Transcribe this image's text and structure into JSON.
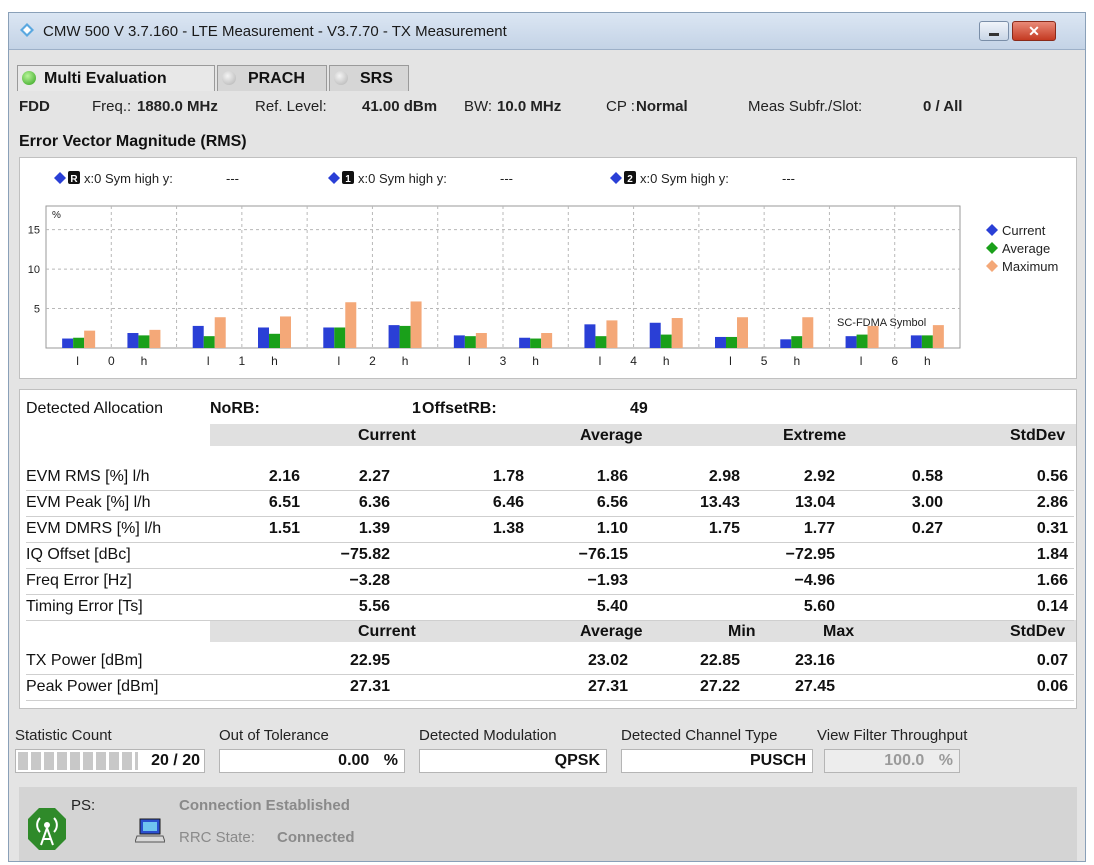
{
  "window": {
    "title": "CMW 500 V 3.7.160 - LTE Measurement  - V3.7.70 - TX Measurement",
    "close_glyph": "✕"
  },
  "tabs": [
    {
      "label": "Multi Evaluation",
      "active": true,
      "led": "#3fbf2a"
    },
    {
      "label": "PRACH",
      "active": false,
      "led": "#c8c8c8"
    },
    {
      "label": "SRS",
      "active": false,
      "led": "#c8c8c8"
    }
  ],
  "info": {
    "duplex": "FDD",
    "freq_label": "Freq.:",
    "freq_value": "1880.0 MHz",
    "ref_label": "Ref. Level:",
    "ref_value": "41.00 dBm",
    "bw_label": "BW:",
    "bw_value": "10.0 MHz",
    "cp_label": "CP :",
    "cp_value": "Normal",
    "subfr_label": "Meas Subfr./Slot:",
    "subfr_value": "0  / All"
  },
  "section_title": "Error Vector Magnitude (RMS)",
  "markers": [
    {
      "tag": "R",
      "text": "x:0 Sym high y:",
      "value": "---"
    },
    {
      "tag": "1",
      "text": "x:0 Sym high y:",
      "value": "---"
    },
    {
      "tag": "2",
      "text": "x:0 Sym high y:",
      "value": "---"
    }
  ],
  "chart_data": {
    "type": "bar",
    "ylabel": "%",
    "ylim": [
      0,
      18
    ],
    "yticks": [
      5,
      10,
      15
    ],
    "grid": true,
    "legend_position": "right",
    "annotation": "SC-FDMA Symbol",
    "categories": [
      "0 l",
      "0 h",
      "1 l",
      "1 h",
      "2 l",
      "2 h",
      "3 l",
      "3 h",
      "4 l",
      "4 h",
      "5 l",
      "5 h",
      "6 l",
      "6 h"
    ],
    "tick_labels": [
      {
        "l": "l",
        "n": "0",
        "h": "h"
      },
      {
        "l": "l",
        "n": "1",
        "h": "h"
      },
      {
        "l": "l",
        "n": "2",
        "h": "h"
      },
      {
        "l": "l",
        "n": "3",
        "h": "h"
      },
      {
        "l": "l",
        "n": "4",
        "h": "h"
      },
      {
        "l": "l",
        "n": "5",
        "h": "h"
      },
      {
        "l": "l",
        "n": "6",
        "h": "h"
      }
    ],
    "series": [
      {
        "name": "Current",
        "color": "#2a3fd6",
        "values": [
          1.2,
          1.9,
          2.8,
          2.6,
          2.6,
          2.9,
          1.6,
          1.3,
          3.0,
          3.2,
          1.4,
          1.1,
          1.5,
          1.6
        ]
      },
      {
        "name": "Average",
        "color": "#1aa01a",
        "values": [
          1.3,
          1.6,
          1.5,
          1.8,
          2.6,
          2.8,
          1.5,
          1.2,
          1.5,
          1.7,
          1.4,
          1.5,
          1.7,
          1.6
        ]
      },
      {
        "name": "Maximum",
        "color": "#f4a878",
        "values": [
          2.2,
          2.3,
          3.9,
          4.0,
          5.8,
          5.9,
          1.9,
          1.9,
          3.5,
          3.8,
          3.9,
          3.9,
          2.8,
          2.9
        ]
      }
    ]
  },
  "table": {
    "detected_label": "Detected Allocation",
    "norb_label": "NoRB:",
    "norb_value": "1",
    "offset_label": "OffsetRB:",
    "offset_value": "49",
    "header1": [
      "Current",
      "Average",
      "Extreme",
      "StdDev"
    ],
    "rows1": [
      {
        "label": "EVM RMS [%] l/h",
        "v": [
          "2.16",
          "2.27",
          "1.78",
          "1.86",
          "2.98",
          "2.92",
          "0.58",
          "0.56"
        ]
      },
      {
        "label": "EVM Peak [%] l/h",
        "v": [
          "6.51",
          "6.36",
          "6.46",
          "6.56",
          "13.43",
          "13.04",
          "3.00",
          "2.86"
        ]
      },
      {
        "label": "EVM DMRS [%] l/h",
        "v": [
          "1.51",
          "1.39",
          "1.38",
          "1.10",
          "1.75",
          "1.77",
          "0.27",
          "0.31"
        ]
      }
    ],
    "rows2": [
      {
        "label": "IQ Offset [dBc]",
        "v": [
          "−75.82",
          "−76.15",
          "−72.95",
          "1.84"
        ]
      },
      {
        "label": "Freq Error [Hz]",
        "v": [
          "−3.28",
          "−1.93",
          "−4.96",
          "1.66"
        ]
      },
      {
        "label": "Timing Error [Ts]",
        "v": [
          "5.56",
          "5.40",
          "5.60",
          "0.14"
        ]
      }
    ],
    "header2": [
      "Current",
      "Average",
      "Min",
      "Max",
      "StdDev"
    ],
    "rows3": [
      {
        "label": "TX Power [dBm]",
        "v": [
          "22.95",
          "23.02",
          "22.85",
          "23.16",
          "0.07"
        ]
      },
      {
        "label": "Peak Power [dBm]",
        "v": [
          "27.31",
          "27.31",
          "27.22",
          "27.45",
          "0.06"
        ]
      }
    ]
  },
  "bottom": {
    "stat_label": "Statistic Count",
    "stat_value": "20 / 20",
    "stat_progress": 1.0,
    "oot_label": "Out of Tolerance",
    "oot_value": "0.00",
    "oot_unit": "%",
    "mod_label": "Detected Modulation",
    "mod_value": "QPSK",
    "chan_label": "Detected Channel Type",
    "chan_value": "PUSCH",
    "vft_label": "View Filter Throughput",
    "vft_value": "100.0",
    "vft_unit": "%"
  },
  "status": {
    "ps_label": "PS:",
    "connection": "Connection Established",
    "rrc_label": "RRC State:",
    "rrc_value": "Connected"
  }
}
